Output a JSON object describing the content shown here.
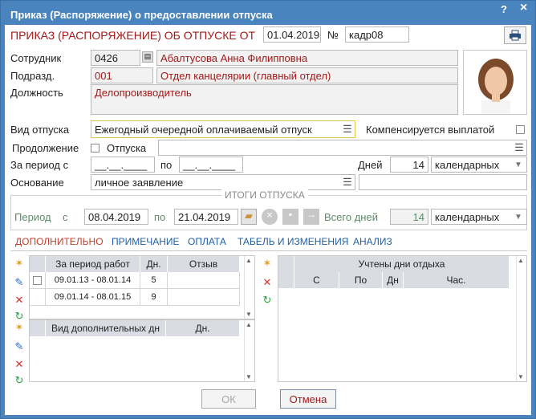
{
  "window": {
    "title": "Приказ (Распоряжение) о предоставлении отпуска",
    "help": "?",
    "close": "×"
  },
  "header": {
    "title": "ПРИКАЗ (РАСПОРЯЖЕНИЕ) ОБ ОТПУСКЕ  ОТ",
    "date": "01.04.2019",
    "number_label": "№",
    "number": "кадр08"
  },
  "employee": {
    "label": "Сотрудник",
    "code": "0426",
    "name": "Абалтусова Анна Филипповна",
    "dept_label": "Подразд.",
    "dept_code": "001",
    "dept_name": "Отдел канцелярии (главный отдел)",
    "position_label": "Должность",
    "position": "Делопроизводитель"
  },
  "leave": {
    "type_label": "Вид отпуска",
    "type_value": "Ежегодный очередной оплачиваемый отпуск",
    "compensated_label": "Компенсируется выплатой",
    "continuation_label": "Продолжение",
    "leave_label": "Отпуска",
    "period_label": "За период с",
    "period_from": "__.__.____",
    "period_to_label": "по",
    "period_to": "__.__.____",
    "days_label": "Дней",
    "days": "14",
    "days_unit": "календарных",
    "basis_label": "Основание",
    "basis": "личное заявление"
  },
  "totals": {
    "title": "ИТОГИ ОТПУСКА",
    "period_label": "Период",
    "from_label": "с",
    "from": "08.04.2019",
    "to_label": "по",
    "to": "21.04.2019",
    "total_days_label": "Всего дней",
    "total_days": "14",
    "unit": "календарных"
  },
  "tabs": [
    "ДОПОЛНИТЕЛЬНО",
    "ПРИМЕЧАНИЕ",
    "ОПЛАТА",
    "ТАБЕЛЬ И ИЗМЕНЕНИЯ",
    "АНАЛИЗ"
  ],
  "work_period_table": {
    "columns": [
      "За период работ",
      "Дн.",
      "Отзыв"
    ],
    "rows": [
      {
        "period": "09.01.13 - 08.01.14",
        "days": "5",
        "recall": ""
      },
      {
        "period": "09.01.14 - 08.01.15",
        "days": "9",
        "recall": ""
      }
    ]
  },
  "additional_table": {
    "columns": [
      "Вид дополнительных дн",
      "Дн."
    ]
  },
  "rest_days_table": {
    "title": "Учтены дни отдыха",
    "columns": [
      "С",
      "По",
      "Дн",
      "Час."
    ]
  },
  "buttons": {
    "ok": "ОК",
    "cancel": "Отмена"
  },
  "colors": {
    "titlebar": "#4a84bf",
    "accent_red": "#a11a1a",
    "tab_blue": "#1f5fa6",
    "tab_active": "#c23e2a"
  }
}
